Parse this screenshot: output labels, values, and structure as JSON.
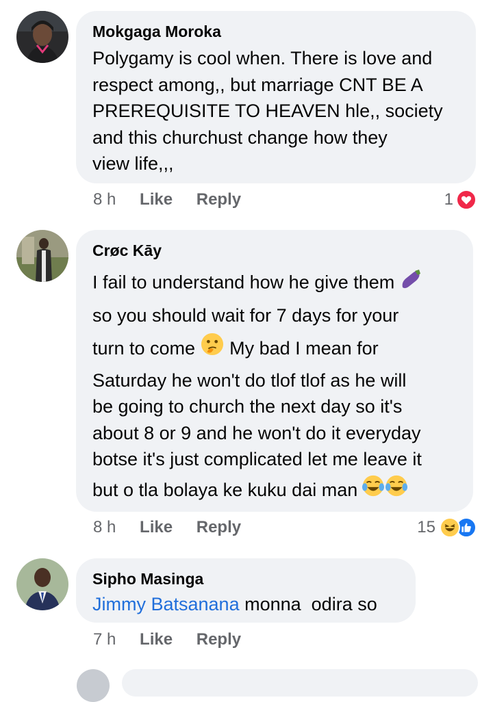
{
  "comments": [
    {
      "author": "Mokgaga Moroka",
      "lines": [
        "Polygamy is cool when. There is love and",
        "respect among,, but marriage CNT BE A",
        "PREREQUISITE TO HEAVEN hle,, society",
        "and this churchust change how they",
        "view life,,,"
      ],
      "time": "8 h",
      "like_label": "Like",
      "reply_label": "Reply",
      "reaction_count": "1",
      "reactions": [
        "heart-icon"
      ]
    },
    {
      "author": "Crøc Kāy",
      "lines": [
        "I fail to understand how he give them",
        "so you should wait for 7 days for your",
        "turn to come",
        "My bad I mean for",
        "Saturday he won't do tlof tlof as he will",
        "be going to church the next day so it's",
        "about 8 or 9 and he won't do it everyday",
        "botse it's just complicated let me leave it",
        "but o tla bolaya ke kuku dai man"
      ],
      "time": "8 h",
      "like_label": "Like",
      "reply_label": "Reply",
      "reaction_count": "15",
      "reactions": [
        "laugh-icon",
        "like-icon"
      ]
    },
    {
      "author": "Sipho Masinga",
      "mention": "Jimmy Batsanana",
      "text": "monna  odira so",
      "time": "7 h",
      "like_label": "Like",
      "reply_label": "Reply"
    }
  ],
  "colors": {
    "bubble": "#f0f2f5",
    "meta": "#65676b",
    "mention": "#216fdb",
    "heart": "#f02849",
    "like": "#1877f2"
  }
}
